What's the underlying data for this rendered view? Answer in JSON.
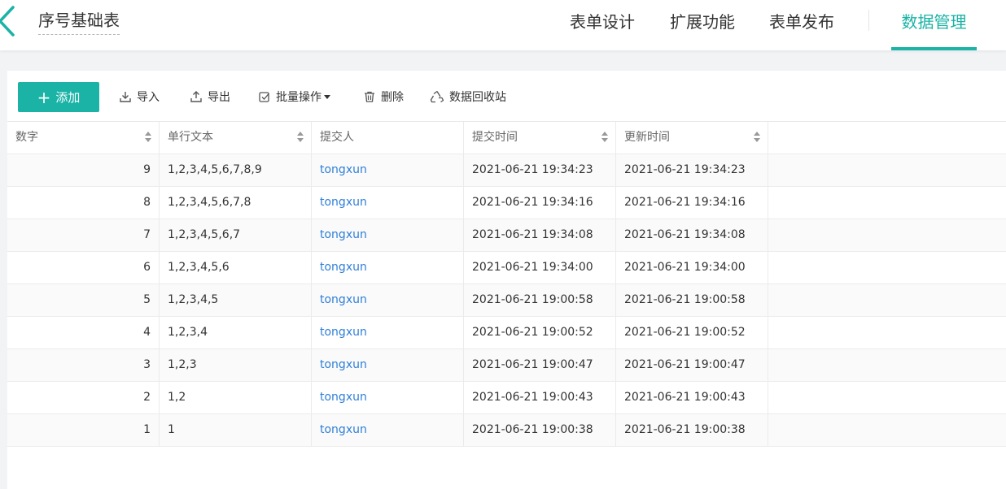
{
  "header": {
    "title": "序号基础表",
    "tabs": [
      {
        "label": "表单设计",
        "active": false
      },
      {
        "label": "扩展功能",
        "active": false
      },
      {
        "label": "表单发布",
        "active": false
      },
      {
        "label": "数据管理",
        "active": true
      }
    ]
  },
  "theme": {
    "accent": "#1ab3a6",
    "link": "#2f7fd8"
  },
  "toolbar": {
    "add_label": "添加",
    "import_label": "导入",
    "export_label": "导出",
    "batch_label": "批量操作",
    "delete_label": "删除",
    "recycle_label": "数据回收站"
  },
  "table": {
    "columns": [
      "数字",
      "单行文本",
      "提交人",
      "提交时间",
      "更新时间"
    ],
    "rows": [
      {
        "num": "9",
        "text": "1,2,3,4,5,6,7,8,9",
        "submitter": "tongxun",
        "submitted": "2021-06-21 19:34:23",
        "updated": "2021-06-21 19:34:23"
      },
      {
        "num": "8",
        "text": "1,2,3,4,5,6,7,8",
        "submitter": "tongxun",
        "submitted": "2021-06-21 19:34:16",
        "updated": "2021-06-21 19:34:16"
      },
      {
        "num": "7",
        "text": "1,2,3,4,5,6,7",
        "submitter": "tongxun",
        "submitted": "2021-06-21 19:34:08",
        "updated": "2021-06-21 19:34:08"
      },
      {
        "num": "6",
        "text": "1,2,3,4,5,6",
        "submitter": "tongxun",
        "submitted": "2021-06-21 19:34:00",
        "updated": "2021-06-21 19:34:00"
      },
      {
        "num": "5",
        "text": "1,2,3,4,5",
        "submitter": "tongxun",
        "submitted": "2021-06-21 19:00:58",
        "updated": "2021-06-21 19:00:58"
      },
      {
        "num": "4",
        "text": "1,2,3,4",
        "submitter": "tongxun",
        "submitted": "2021-06-21 19:00:52",
        "updated": "2021-06-21 19:00:52"
      },
      {
        "num": "3",
        "text": "1,2,3",
        "submitter": "tongxun",
        "submitted": "2021-06-21 19:00:47",
        "updated": "2021-06-21 19:00:47"
      },
      {
        "num": "2",
        "text": "1,2",
        "submitter": "tongxun",
        "submitted": "2021-06-21 19:00:43",
        "updated": "2021-06-21 19:00:43"
      },
      {
        "num": "1",
        "text": "1",
        "submitter": "tongxun",
        "submitted": "2021-06-21 19:00:38",
        "updated": "2021-06-21 19:00:38"
      }
    ]
  }
}
